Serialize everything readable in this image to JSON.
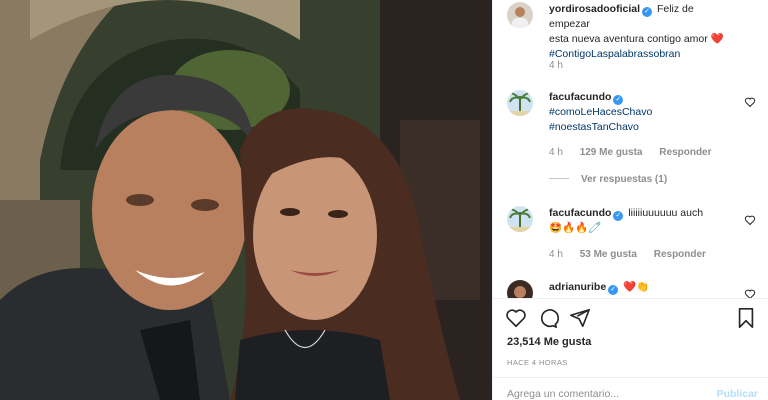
{
  "post": {
    "author": "yordirosadooficial",
    "caption_line1": "Feliz de empezar",
    "caption_line2": "esta nueva aventura contigo amor",
    "caption_heart": "❤️",
    "caption_tag": "#ContigoLaspalabrassobran",
    "caption_age": "4 h"
  },
  "comments": [
    {
      "user": "facufacundo",
      "lines": [
        "#comoLeHacesChavo",
        "#noestasTanChavo"
      ],
      "age": "4 h",
      "likes": "129 Me gusta",
      "reply": "Responder",
      "view_replies": "Ver respuestas (1)"
    },
    {
      "user": "facufacundo",
      "text": "liiiiiuuuuuu auch",
      "emojis": "🤩🔥🔥🧷",
      "age": "4 h",
      "likes": "53 Me gusta",
      "reply": "Responder"
    },
    {
      "user": "adrianuribe",
      "emojis": "❤️👏"
    }
  ],
  "footer": {
    "likes": "23,514 Me gusta",
    "time": "HACE 4 HORAS",
    "add_comment_placeholder": "Agrega un comentario...",
    "publish": "Publicar"
  },
  "icons": {
    "verified": "verified-badge-icon",
    "heart": "heart-icon",
    "comment": "comment-icon",
    "share": "share-icon",
    "save": "bookmark-icon"
  },
  "colors": {
    "link": "#00376b",
    "verified": "#3897f0",
    "muted": "#8e8e8e",
    "heart_red": "#ed4956"
  }
}
